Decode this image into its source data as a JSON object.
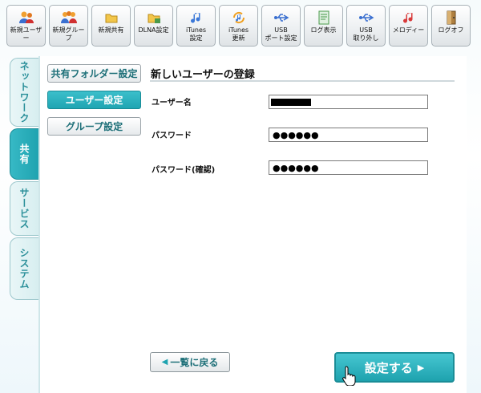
{
  "toolbar": [
    {
      "label": "新規ユーザー",
      "icon": "users-icon"
    },
    {
      "label": "新規グループ",
      "icon": "group-icon"
    },
    {
      "label": "新規共有",
      "icon": "folder-icon"
    },
    {
      "label": "DLNA設定",
      "icon": "dlna-icon"
    },
    {
      "label": "iTunes\n設定",
      "icon": "itunes-note-icon"
    },
    {
      "label": "iTunes\n更新",
      "icon": "itunes-refresh-icon"
    },
    {
      "label": "USB\nポート設定",
      "icon": "usb-icon"
    },
    {
      "label": "ログ表示",
      "icon": "log-document-icon"
    },
    {
      "label": "USB\n取り外し",
      "icon": "usb-remove-icon"
    },
    {
      "label": "メロディー",
      "icon": "melody-icon"
    },
    {
      "label": "ログオフ",
      "icon": "logoff-door-icon"
    }
  ],
  "side_tabs": [
    {
      "label": "ネットワーク",
      "active": false
    },
    {
      "label": "共有",
      "active": true
    },
    {
      "label": "サービス",
      "active": false
    },
    {
      "label": "システム",
      "active": false
    }
  ],
  "subnav": [
    {
      "label": "共有フォルダー設定",
      "active": false
    },
    {
      "label": "ユーザー設定",
      "active": true
    },
    {
      "label": "グループ設定",
      "active": false
    }
  ],
  "form": {
    "title": "新しいユーザーの登録",
    "username_label": "ユーザー名",
    "username_value": "",
    "password_label": "パスワード",
    "password_value": "●●●●●●",
    "confirm_label": "パスワード(確認)",
    "confirm_value": "●●●●●●"
  },
  "actions": {
    "back_label": "一覧に戻る",
    "submit_label": "設定する"
  },
  "colors": {
    "accent": "#1fa3b0",
    "accent_dark": "#1a8c97"
  }
}
